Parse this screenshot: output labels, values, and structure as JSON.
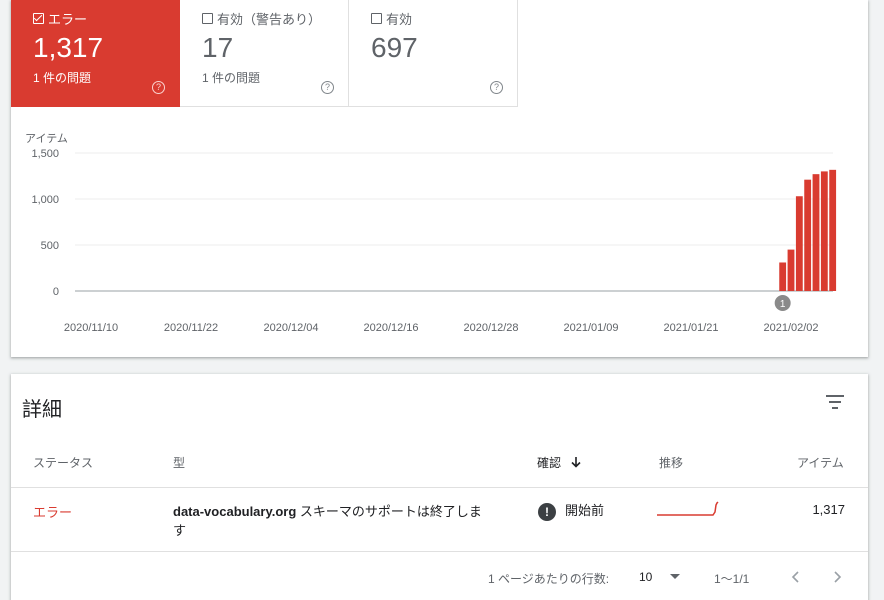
{
  "tiles": [
    {
      "label": "エラー",
      "value": "1,317",
      "sub": "1 件の問題",
      "active": true
    },
    {
      "label": "有効（警告あり）",
      "value": "17",
      "sub": "1 件の問題",
      "active": false
    },
    {
      "label": "有効",
      "value": "697",
      "sub": "",
      "active": false
    }
  ],
  "help_glyph": "?",
  "chart_data": {
    "type": "bar",
    "ylabel": "アイテム",
    "ylim": [
      0,
      1500
    ],
    "yticks": [
      "1,500",
      "1,000",
      "500",
      "0"
    ],
    "xticks": [
      "2020/11/10",
      "2020/11/22",
      "2020/12/04",
      "2020/12/16",
      "2020/12/28",
      "2021/01/09",
      "2021/01/21",
      "2021/02/02"
    ],
    "bars": [
      {
        "date": "2021/02/01",
        "value": 310
      },
      {
        "date": "2021/02/02",
        "value": 450
      },
      {
        "date": "2021/02/03",
        "value": 1030
      },
      {
        "date": "2021/02/04",
        "value": 1210
      },
      {
        "date": "2021/02/05",
        "value": 1270
      },
      {
        "date": "2021/02/06",
        "value": 1300
      },
      {
        "date": "2021/02/07",
        "value": 1317
      }
    ],
    "annotation": {
      "date": "2021/02/01",
      "label": "1"
    },
    "bar_color": "#d93b30"
  },
  "details": {
    "title": "詳細",
    "columns": {
      "status": "ステータス",
      "type": "型",
      "validation": "確認",
      "trend": "推移",
      "items": "アイテム"
    },
    "rows": [
      {
        "status": "エラー",
        "type_bold": "data-vocabulary.org",
        "type_rest": " スキーマのサポートは終了します",
        "validation": "開始前",
        "items": "1,317"
      }
    ]
  },
  "pagination": {
    "rows_per_page_label": "1 ページあたりの行数:",
    "rows_per_page": "10",
    "range": "1〜1/1"
  }
}
